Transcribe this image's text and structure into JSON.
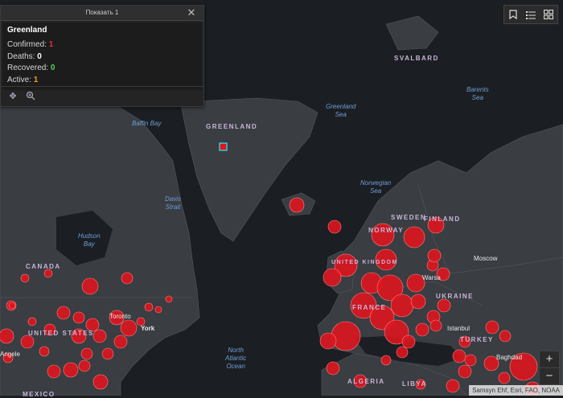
{
  "popup": {
    "title": "Показать 1",
    "heading": "Greenland",
    "confirmed_label": "Confirmed: ",
    "confirmed_value": "1",
    "deaths_label": "Deaths: ",
    "deaths_value": "0",
    "recovered_label": "Recovered: ",
    "recovered_value": "0",
    "active_label": "Active: ",
    "active_value": "1",
    "colors": {
      "confirmed": "#e0303a",
      "deaths": "#ffffff",
      "recovered": "#5ad15a",
      "active": "#f0a020"
    }
  },
  "toolbar": {
    "icons": [
      "bookmark-icon",
      "legend-list-icon",
      "basemap-gallery-icon"
    ]
  },
  "zoom": {
    "in_label": "+",
    "out_label": "−"
  },
  "attribution": "Samsyn Ehf, Esri, FAO, NOAA",
  "map_labels": {
    "svalbard": "SVALBARD",
    "barents_sea_1": "Barents",
    "barents_sea_2": "Sea",
    "greenland_sea_1": "Greenland",
    "greenland_sea_2": "Sea",
    "baffin_bay": "Baffin Bay",
    "greenland": "GREENLAND",
    "norwegian_sea_1": "Norwegian",
    "norwegian_sea_2": "Sea",
    "davis_strait_1": "Davis",
    "davis_strait_2": "Strait",
    "hudson_bay_1": "Hudson",
    "hudson_bay_2": "Bay",
    "canada": "CANADA",
    "sweden": "SWEDEN",
    "finland": "FINLAND",
    "norway": "NORWAY",
    "moscow": "Moscow",
    "warsaw": "Warsa",
    "ukraine": "UKRAINE",
    "istanbul": "Istanbul",
    "turkey": "TURKEY",
    "united_kingdom": "UNITED KINGDOM",
    "france": "FRANCE",
    "toronto": "Toronto",
    "new_york": "York",
    "united_states": "UNITED STATES",
    "angeles": "Angele",
    "north_atlantic_1": "North",
    "north_atlantic_2": "Atlantic",
    "north_atlantic_3": "Ocean",
    "algeria": "ALGERIA",
    "libya": "LIBYA",
    "baghdad": "Baghdad",
    "mexico": "MEXICO"
  },
  "map_colors": {
    "ocean": "#1b1e22",
    "land": "#3a3d42",
    "border": "#5a5d62",
    "bubble": "#e0141e",
    "highlight": "#39c9d6"
  }
}
